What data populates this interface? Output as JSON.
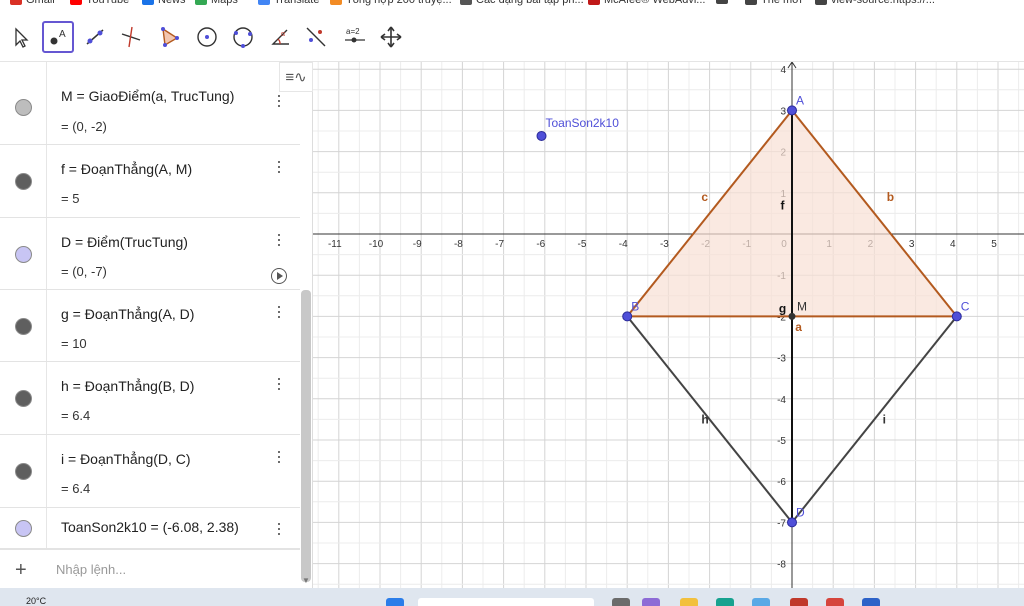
{
  "bookmarks": [
    {
      "label": "Gmail",
      "icon": "gmail-icon",
      "color": "#d93025"
    },
    {
      "label": "YouTube",
      "icon": "youtube-icon",
      "color": "#ff0000"
    },
    {
      "label": "News",
      "icon": "news-icon",
      "color": "#1a73e8"
    },
    {
      "label": "Maps",
      "icon": "maps-icon",
      "color": "#34a853"
    },
    {
      "label": "Translate",
      "icon": "translate-icon",
      "color": "#4285f4"
    },
    {
      "label": "Tổng hợp 200 truyệ...",
      "icon": "page-icon",
      "color": "#f28b24"
    },
    {
      "label": "Các dạng bài tập ph...",
      "icon": "page-icon",
      "color": "#555555"
    },
    {
      "label": "McAfee® WebAdvi...",
      "icon": "mcafee-icon",
      "color": "#c01818"
    },
    {
      "label": "",
      "icon": "globe-icon",
      "color": "#444444"
    },
    {
      "label": "Thế mới",
      "icon": "globe-icon",
      "color": "#444444"
    },
    {
      "label": "view-source:https://...",
      "icon": "globe-icon",
      "color": "#444444"
    }
  ],
  "toolbar": {
    "tools": [
      {
        "name": "move-tool",
        "icon": "cursor-arrow-icon"
      },
      {
        "name": "point-tool",
        "icon": "point-icon",
        "active": true
      },
      {
        "name": "line-tool",
        "icon": "line-icon"
      },
      {
        "name": "perpendicular-line-tool",
        "icon": "perpendicular-icon"
      },
      {
        "name": "polygon-tool",
        "icon": "polygon-icon"
      },
      {
        "name": "circle-tool",
        "icon": "circle-center-icon"
      },
      {
        "name": "circle-3-points-tool",
        "icon": "circle-three-points-icon"
      },
      {
        "name": "angle-tool",
        "icon": "angle-icon"
      },
      {
        "name": "reflect-tool",
        "icon": "reflect-line-icon"
      },
      {
        "name": "slider-tool",
        "icon": "slider-icon",
        "label": "a=2"
      },
      {
        "name": "move-graphics-tool",
        "icon": "move-arrows-icon"
      }
    ],
    "active_color": "#6557d2"
  },
  "algebra": {
    "style_toggle": "≡∿",
    "rows": [
      {
        "def": "M = GiaoĐiểm(a, TrucTung)",
        "val": "= (0, -2)",
        "color": "#bdbdbd",
        "dot": "grey"
      },
      {
        "def": "f = ĐoạnThẳng(A, M)",
        "val": "= 5",
        "color": "#5f5f5f",
        "dot": "dark"
      },
      {
        "def": "D = Điểm(TrucTung)",
        "val": "= (0, -7)",
        "color": "#c8c5f4",
        "dot": "lavender"
      },
      {
        "def": "g = ĐoạnThẳng(A, D)",
        "val": "= 10",
        "color": "#5f5f5f",
        "dot": "dark"
      },
      {
        "def": "h = ĐoạnThẳng(B, D)",
        "val": "= 6.4",
        "color": "#5f5f5f",
        "dot": "dark"
      },
      {
        "def": "i = ĐoạnThẳng(D, C)",
        "val": "= 6.4",
        "color": "#5f5f5f",
        "dot": "dark"
      },
      {
        "def": "ToanSon2k10 = (-6.08, 2.38)",
        "val": "",
        "color": "#c8c5f4",
        "dot": "lavender"
      }
    ],
    "input_placeholder": "Nhập lệnh..."
  },
  "graphics": {
    "x_ticks": [
      "-11",
      "-10",
      "-9",
      "-8",
      "-7",
      "-6",
      "-5",
      "-4",
      "-3",
      "-2",
      "-1",
      "0",
      "1",
      "2",
      "3",
      "4",
      "5"
    ],
    "y_ticks": [
      "4",
      "3",
      "2",
      "1",
      "-1",
      "-2",
      "-3",
      "-4",
      "-5",
      "-6",
      "-7",
      "-8"
    ],
    "points": [
      {
        "label": "A",
        "x": 0,
        "y": 3
      },
      {
        "label": "B",
        "x": -4,
        "y": -2
      },
      {
        "label": "C",
        "x": 4,
        "y": -2
      },
      {
        "label": "D",
        "x": 0,
        "y": -7
      },
      {
        "label": "ToanSon2k10",
        "x": -6.08,
        "y": 2.38
      }
    ],
    "intersection": {
      "label": "M",
      "x": 0,
      "y": -2
    },
    "segment_labels": [
      "c",
      "b",
      "f",
      "g",
      "a",
      "h",
      "i"
    ],
    "triangle_color": "#b35a1f",
    "triangle_fill": "#f8e0d4",
    "segment_color": "#444444",
    "point_color": "#4f4fd8"
  },
  "taskbar": {
    "weather": "20°C"
  }
}
